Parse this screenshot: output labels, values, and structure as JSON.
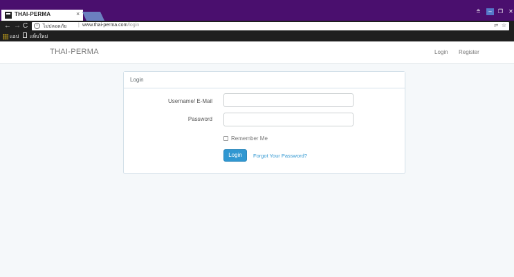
{
  "browser": {
    "tab_title": "THAI-PERMA",
    "tab_close": "×",
    "window_controls": {
      "user": "≗",
      "minimize": "–",
      "maximize": "❐",
      "close": "✕"
    },
    "nav": {
      "back": "←",
      "forward": "→",
      "reload": "C"
    },
    "address": {
      "info_glyph": "i",
      "security_text": "ไม่ปลอดภัย",
      "separator": "|",
      "host": "www.thai-perma.com",
      "path": "/login",
      "translate_glyph": "⇄",
      "bookmark_star": "☆"
    },
    "bookmarks": {
      "apps_label": "แอป",
      "new_tab_label": "แท็บใหม่"
    }
  },
  "navbar": {
    "brand": "THAI-PERMA",
    "links": {
      "login": "Login",
      "register": "Register"
    }
  },
  "login_panel": {
    "heading": "Login",
    "username_label": "Username/ E-Mail",
    "username_value": "",
    "password_label": "Password",
    "password_value": "",
    "remember_label": "Remember Me",
    "remember_checked": false,
    "submit_label": "Login",
    "forgot_link": "Forgot Your Password?"
  },
  "colors": {
    "titlebar": "#4a0f6e",
    "page_background": "#f5f8fa",
    "primary": "#3097d1",
    "panel_border": "#d3e0e9"
  },
  "icons": [
    "favicon-icon",
    "close-icon",
    "back-icon",
    "forward-icon",
    "reload-icon",
    "info-icon",
    "translate-icon",
    "star-icon",
    "apps-icon",
    "document-icon",
    "checkbox-icon"
  ]
}
